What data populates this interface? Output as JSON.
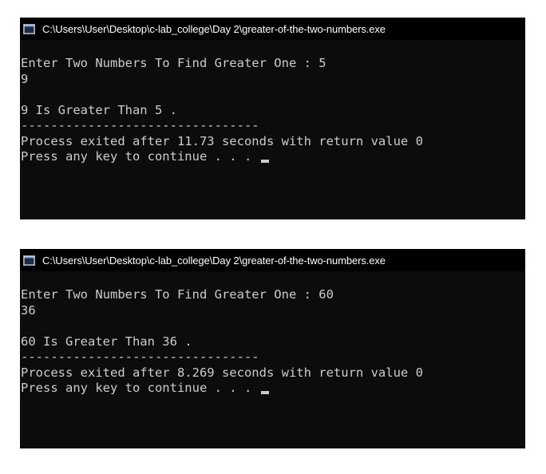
{
  "windows": [
    {
      "title": "C:\\Users\\User\\Desktop\\c-lab_college\\Day 2\\greater-of-the-two-numbers.exe",
      "lines": [
        "Enter Two Numbers To Find Greater One : 5",
        "9",
        "",
        "9 Is Greater Than 5 .",
        "--------------------------------",
        "Process exited after 11.73 seconds with return value 0",
        "Press any key to continue . . . "
      ]
    },
    {
      "title": "C:\\Users\\User\\Desktop\\c-lab_college\\Day 2\\greater-of-the-two-numbers.exe",
      "lines": [
        "Enter Two Numbers To Find Greater One : 60",
        "36",
        "",
        "60 Is Greater Than 36 .",
        "--------------------------------",
        "Process exited after 8.269 seconds with return value 0",
        "Press any key to continue . . . "
      ]
    }
  ],
  "icons": {
    "app": "console-window-icon"
  },
  "colors": {
    "console_background": "#0c0c0c",
    "title_bar_background": "#000000",
    "console_text": "#cccccc",
    "title_text": "#ffffff"
  }
}
